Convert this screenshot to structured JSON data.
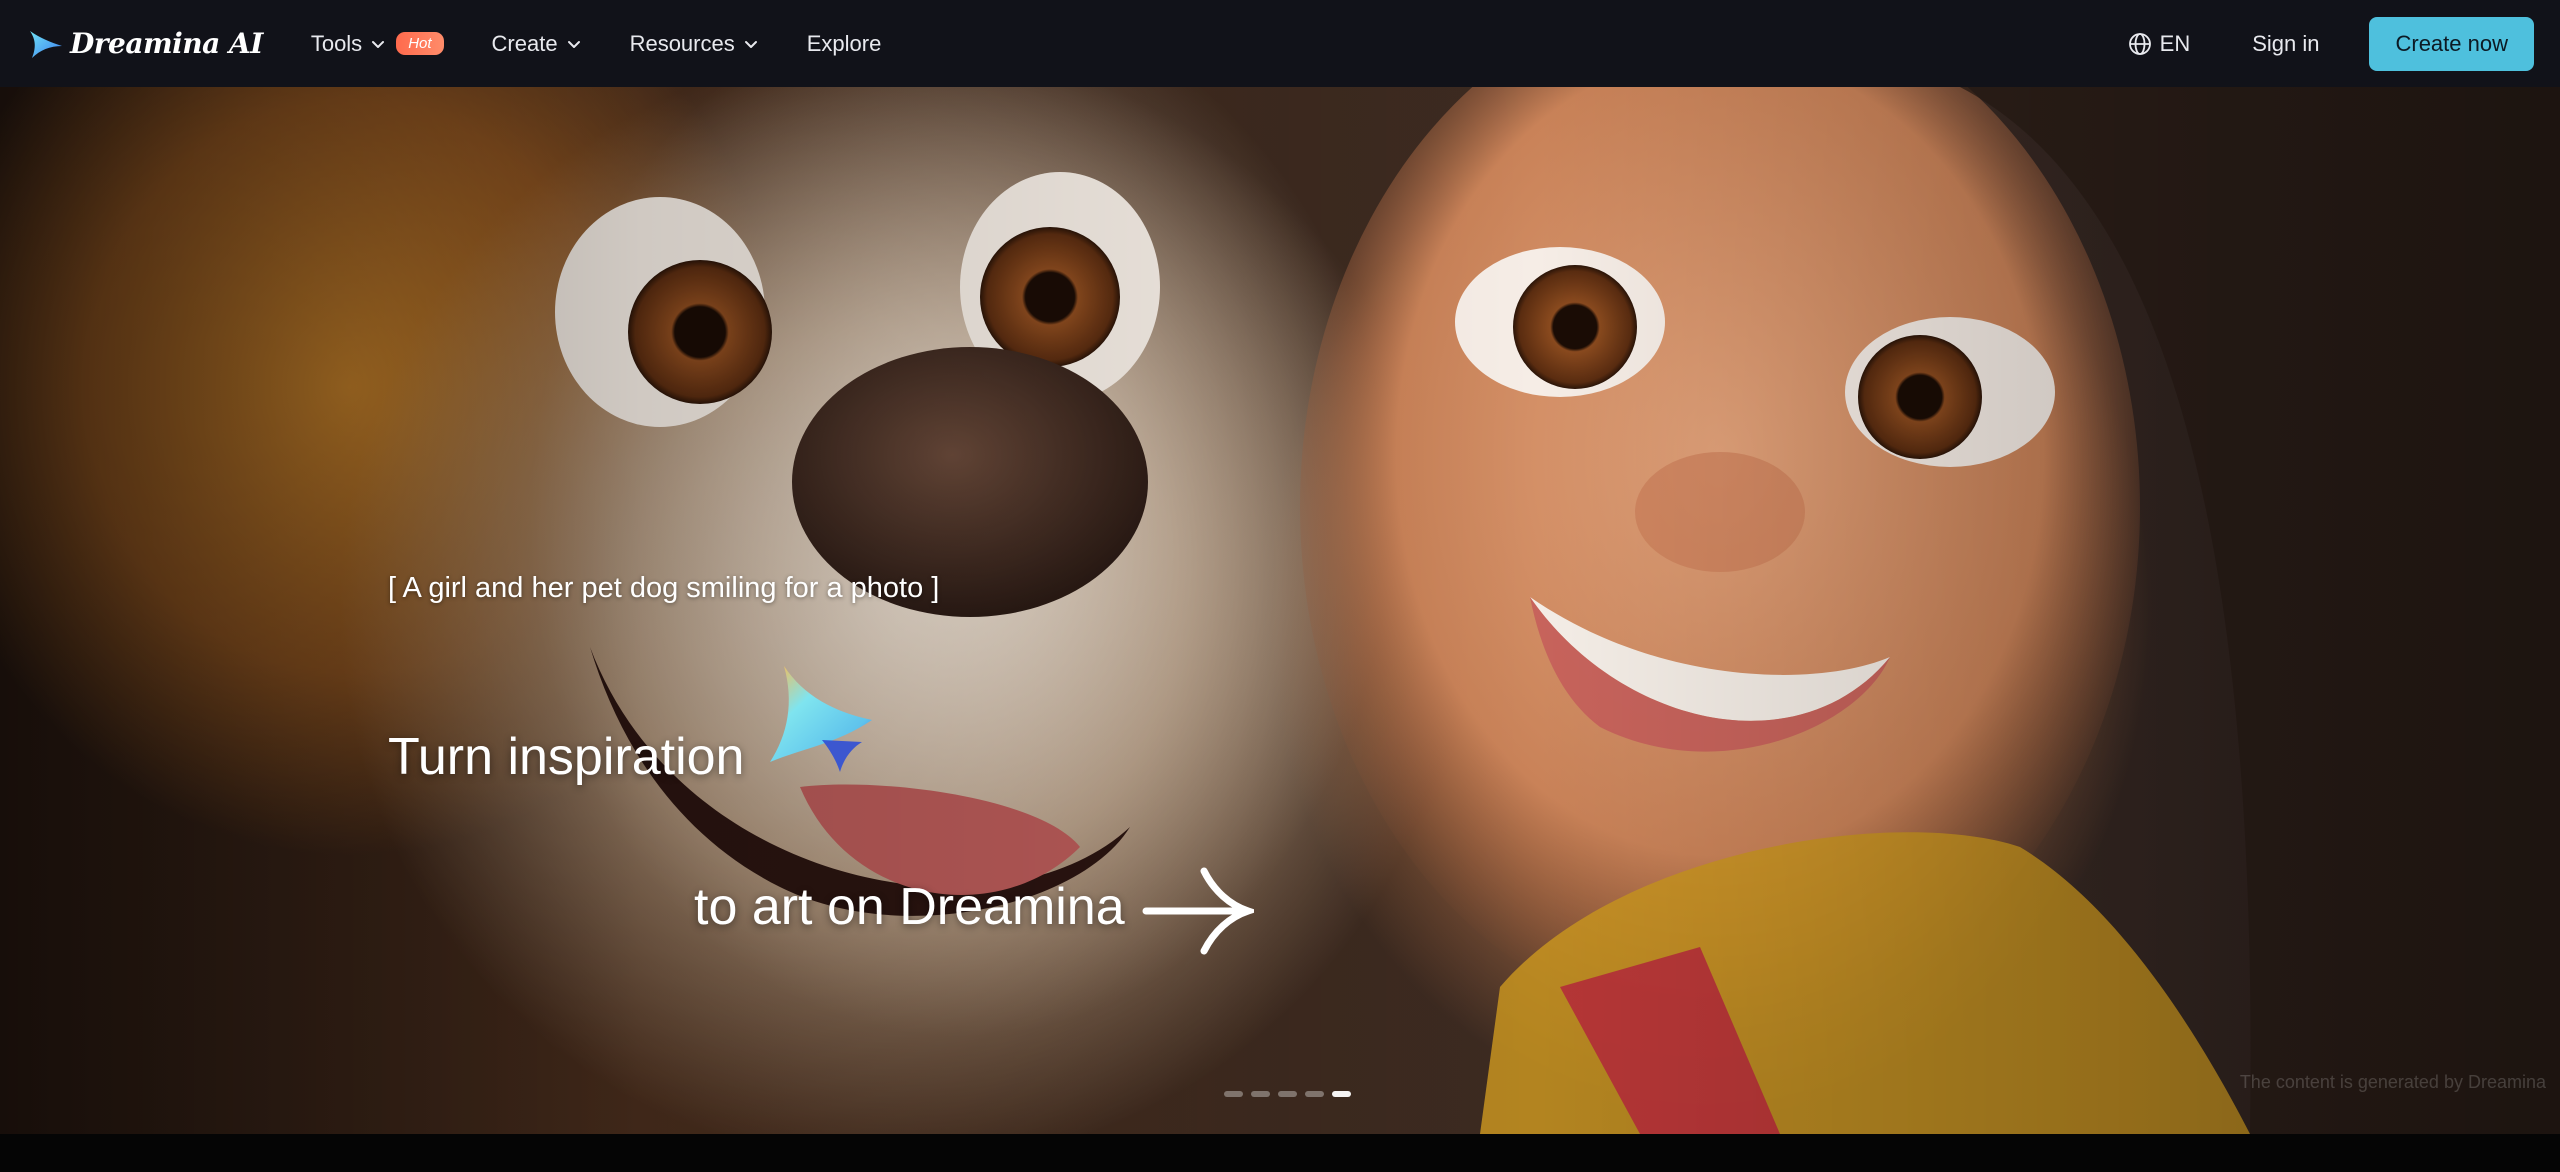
{
  "nav": {
    "logo_text": "Dreamina AI",
    "items": [
      {
        "label": "Tools",
        "badge": "Hot",
        "has_dropdown": true
      },
      {
        "label": "Create",
        "has_dropdown": true
      },
      {
        "label": "Resources",
        "has_dropdown": true
      },
      {
        "label": "Explore",
        "has_dropdown": false
      }
    ],
    "language": "EN",
    "sign_in": "Sign in",
    "create_now": "Create now"
  },
  "hero": {
    "prompt_caption": "[ A girl and her pet dog smiling for a photo ]",
    "headline_line1": "Turn inspiration",
    "headline_line2": "to art on Dreamina",
    "carousel": {
      "total": 5,
      "active_index": 4
    },
    "credit": "The content is generated by Dreamina"
  },
  "colors": {
    "nav_bg": "#111219",
    "accent": "#4ec0dd",
    "hot_badge": "#ff6a4d"
  },
  "icons": {
    "logo": "dreamina-logo-icon",
    "dropdown": "chevron-down-icon",
    "language": "globe-icon",
    "spark": "spark-star-icon",
    "cta": "arrow-right-icon"
  }
}
